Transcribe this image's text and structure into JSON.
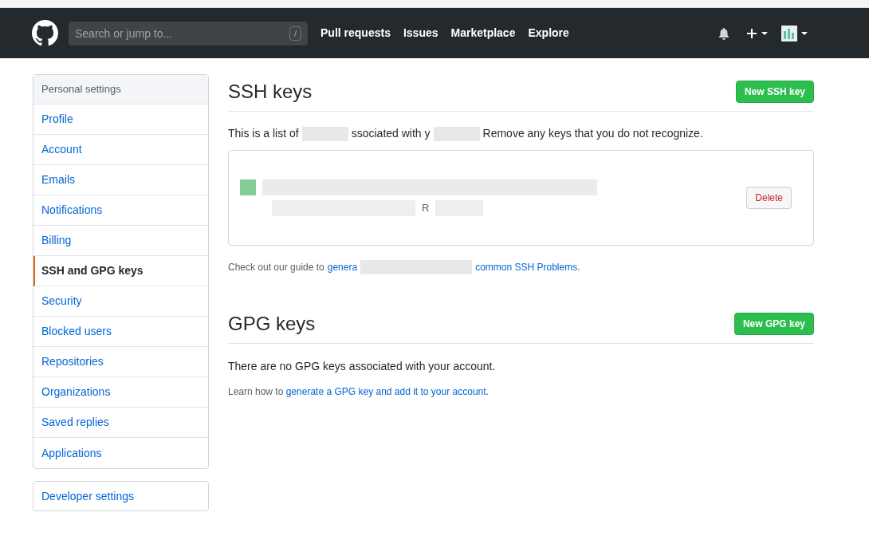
{
  "header": {
    "search": {
      "placeholder": "Search or jump to...",
      "shortcut": "/"
    },
    "nav": [
      "Pull requests",
      "Issues",
      "Marketplace",
      "Explore"
    ]
  },
  "sidebar": {
    "title": "Personal settings",
    "items": [
      {
        "label": "Profile",
        "selected": false
      },
      {
        "label": "Account",
        "selected": false
      },
      {
        "label": "Emails",
        "selected": false
      },
      {
        "label": "Notifications",
        "selected": false
      },
      {
        "label": "Billing",
        "selected": false
      },
      {
        "label": "SSH and GPG keys",
        "selected": true
      },
      {
        "label": "Security",
        "selected": false
      },
      {
        "label": "Blocked users",
        "selected": false
      },
      {
        "label": "Repositories",
        "selected": false
      },
      {
        "label": "Organizations",
        "selected": false
      },
      {
        "label": "Saved replies",
        "selected": false
      },
      {
        "label": "Applications",
        "selected": false
      }
    ],
    "developer": "Developer settings"
  },
  "ssh": {
    "title": "SSH keys",
    "button": "New SSH key",
    "intro": [
      "This is a list of",
      "ssociated with y",
      "Remove any keys that you do not recognize."
    ],
    "key": {
      "visible_letter": "R",
      "delete": "Delete"
    },
    "guide": {
      "prefix": "Check out our guide to",
      "link_start": "genera",
      "link_end": "common SSH Problems",
      "suffix": "."
    }
  },
  "gpg": {
    "title": "GPG keys",
    "button": "New GPG key",
    "empty": "There are no GPG keys associated with your account.",
    "learn": {
      "prefix": "Learn how to",
      "link": "generate a GPG key and add it to your account",
      "suffix": "."
    }
  }
}
